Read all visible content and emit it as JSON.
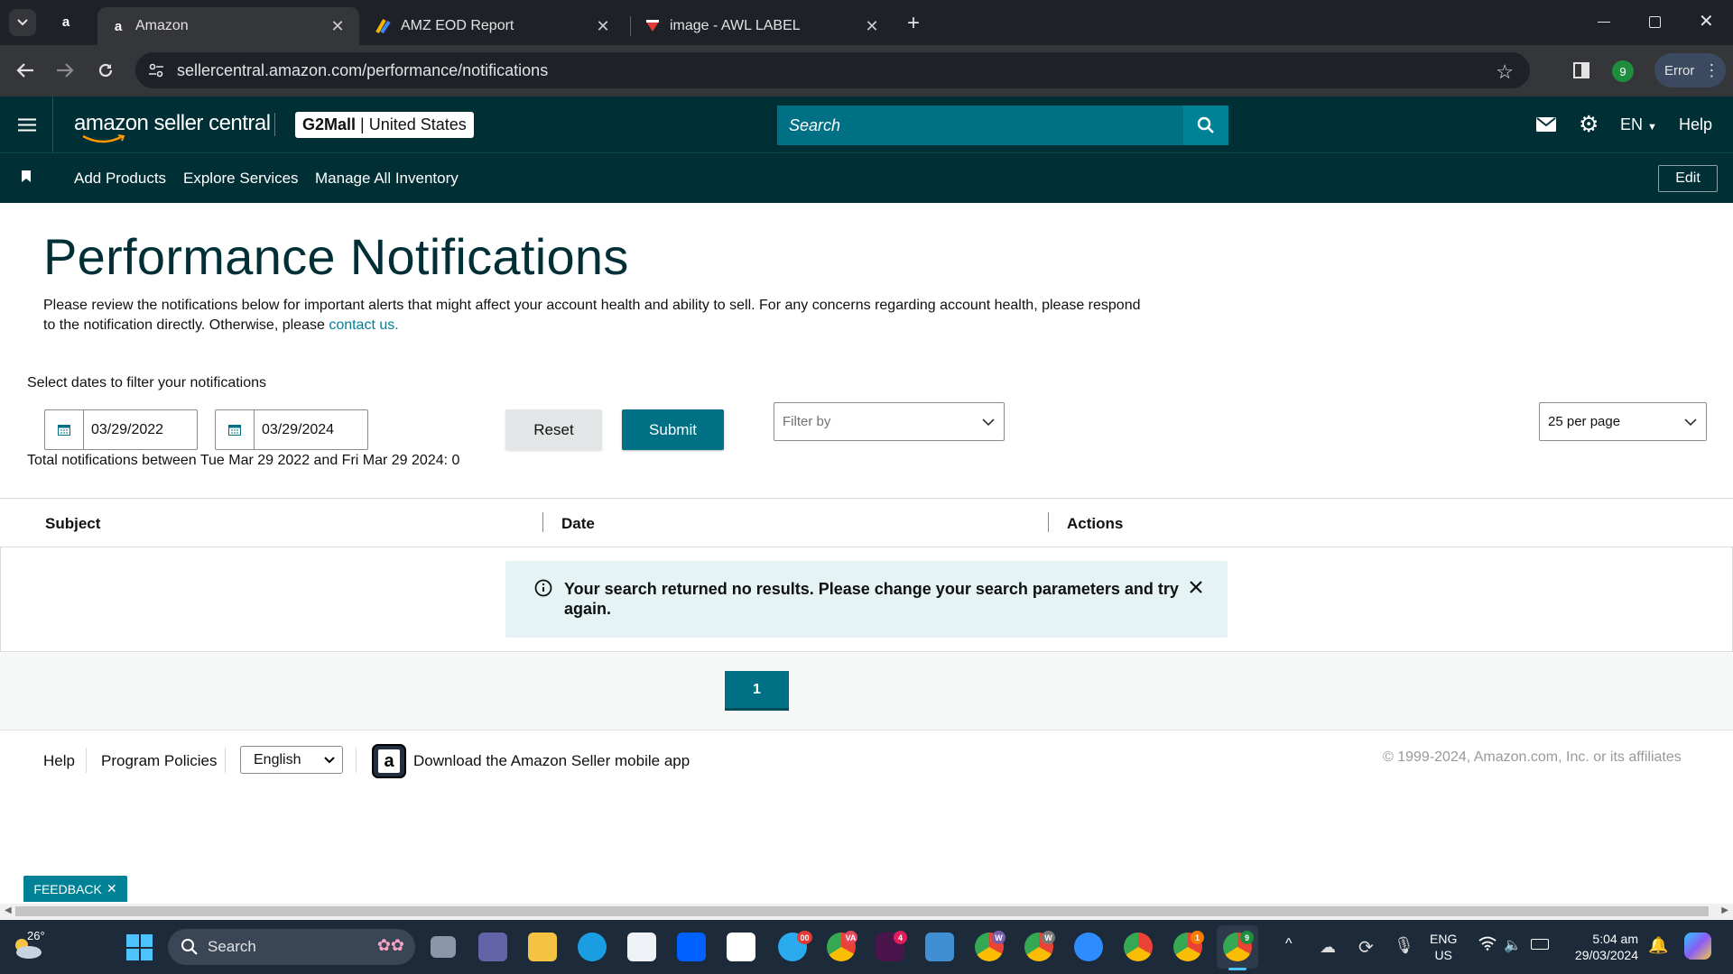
{
  "browser": {
    "tabs": [
      {
        "title": "Amazon",
        "active": true
      },
      {
        "title": "AMZ EOD Report",
        "active": false
      },
      {
        "title": "image - AWL LABEL",
        "active": false
      }
    ],
    "url": "sellercentral.amazon.com/performance/notifications",
    "profile_badge": "9",
    "error_label": "Error"
  },
  "header": {
    "logo_text": "amazon seller central",
    "account_bold": "G2Mall",
    "account_region": "United States",
    "search_placeholder": "Search",
    "language": "EN",
    "help": "Help"
  },
  "nav": {
    "items": [
      "Add Products",
      "Explore Services",
      "Manage All Inventory"
    ],
    "edit": "Edit"
  },
  "page": {
    "title": "Performance Notifications",
    "description": "Please review the notifications below for important alerts that might affect your account health and ability to sell. For any concerns regarding account health, please respond to the notification directly. Otherwise, please",
    "contact_link": "contact us."
  },
  "filters": {
    "label": "Select dates to filter your notifications",
    "start_date": "03/29/2022",
    "end_date": "03/29/2024",
    "reset": "Reset",
    "submit": "Submit",
    "filter_by": "Filter by",
    "per_page": "25 per page",
    "total_text": "Total notifications between Tue Mar 29 2022 and Fri Mar 29 2024: 0"
  },
  "table": {
    "columns": [
      "Subject",
      "Date",
      "Actions"
    ],
    "alert_message": "Your search returned no results. Please change your search parameters and try again."
  },
  "pagination": {
    "current": "1"
  },
  "footer": {
    "help": "Help",
    "policies": "Program Policies",
    "language": "English",
    "mobile_app": "Download the Amazon Seller mobile app",
    "copyright": "© 1999-2024, Amazon.com, Inc. or its affiliates"
  },
  "feedback": "FEEDBACK",
  "taskbar": {
    "weather": "26°",
    "search": "Search",
    "lang_top": "ENG",
    "lang_bottom": "US",
    "time": "5:04 am",
    "date": "29/03/2024",
    "badges": {
      "telegram": "00",
      "chrome_va": "VA",
      "slack": "4",
      "chrome_w1": "W",
      "chrome_w2": "W",
      "chrome_1": "1",
      "chrome_9": "9"
    }
  },
  "colors": {
    "header_bg": "#002f36",
    "accent": "#008296",
    "button_primary": "#007185",
    "alert_bg": "#e6f3f5"
  }
}
